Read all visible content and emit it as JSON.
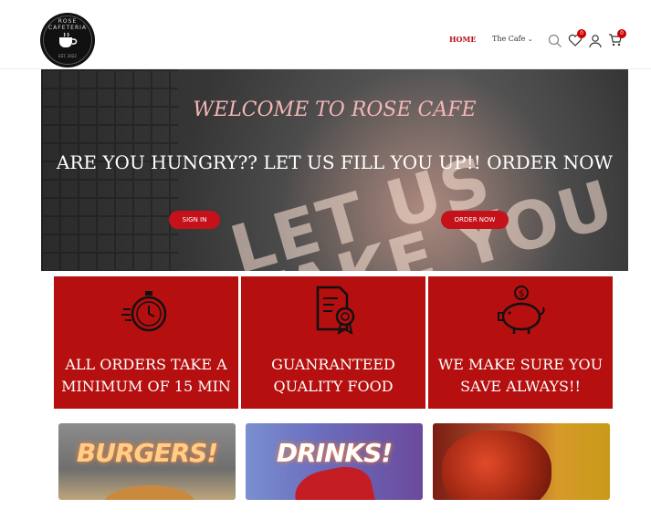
{
  "header": {
    "logo": {
      "brand": "ROSE CAFETERIA",
      "tag": "EST. 2022"
    },
    "nav": {
      "home": "HOME",
      "cafe": "The Cafe"
    },
    "wishlist_count": "0",
    "cart_count": "0"
  },
  "hero": {
    "title": "WELCOME TO ROSE CAFE",
    "subtitle": "ARE YOU HUNGRY?? LET US FILL YOU UP!! ORDER NOW",
    "sign_in_label": "SIGN IN",
    "order_now_label": "ORDER NOW",
    "background_sign": "LET US TAKE YOU HERE"
  },
  "features": [
    {
      "icon": "stopwatch-icon",
      "text_line1": "ALL ORDERS TAKE A",
      "text_line2": "MINIMUM OF 15 MIN"
    },
    {
      "icon": "certificate-icon",
      "text_line1": "GUANRANTEED",
      "text_line2": "QUALITY FOOD"
    },
    {
      "icon": "piggy-bank-icon",
      "text_line1": "WE MAKE SURE YOU",
      "text_line2": "SAVE ALWAYS!!"
    }
  ],
  "categories": [
    {
      "title": "BURGERS!"
    },
    {
      "title": "DRINKS!"
    },
    {
      "title": ""
    }
  ],
  "colors": {
    "brand_red": "#b50f0f",
    "button_red": "#c4111a",
    "accent_pink": "#f4b6b6"
  }
}
